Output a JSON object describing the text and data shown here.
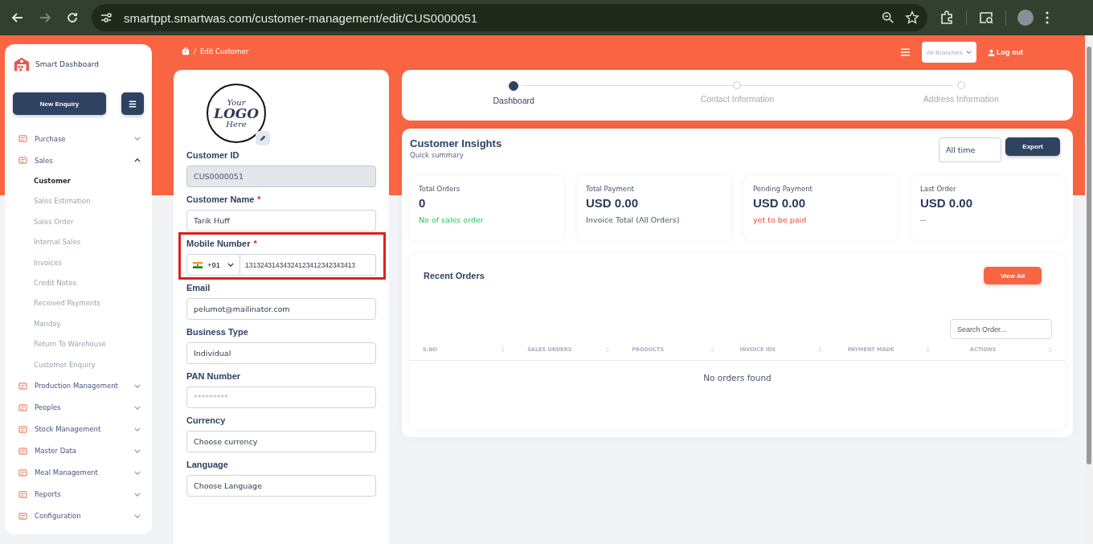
{
  "browser": {
    "url": "smartppt.smartwas.com/customer-management/edit/CUS0000051"
  },
  "sidebar": {
    "brand": "Smart Dashboard",
    "primary_button": "New Enquiry",
    "items": [
      {
        "label": "Purchase",
        "expanded": false
      },
      {
        "label": "Sales",
        "expanded": true,
        "children": [
          {
            "label": "Customer",
            "selected": true
          },
          {
            "label": "Sales Estimation",
            "selected": false
          },
          {
            "label": "Sales Order",
            "selected": false
          },
          {
            "label": "Internal Sales",
            "selected": false
          },
          {
            "label": "Invoices",
            "selected": false
          },
          {
            "label": "Credit Notes",
            "selected": false
          },
          {
            "label": "Received Payments",
            "selected": false
          },
          {
            "label": "Manday",
            "selected": false
          },
          {
            "label": "Return To Warehouse",
            "selected": false
          },
          {
            "label": "Customer Enquiry",
            "selected": false
          }
        ]
      },
      {
        "label": "Production Management",
        "expanded": false
      },
      {
        "label": "Peoples",
        "expanded": false
      },
      {
        "label": "Stock Management",
        "expanded": false
      },
      {
        "label": "Master Data",
        "expanded": false
      },
      {
        "label": "Meal Management",
        "expanded": false
      },
      {
        "label": "Reports",
        "expanded": false
      },
      {
        "label": "Configuration",
        "expanded": false
      }
    ]
  },
  "header": {
    "breadcrumb_separator": "/",
    "breadcrumb": "Edit Customer",
    "branch_placeholder": "All Branches",
    "logout": "Log out"
  },
  "form": {
    "logo": [
      "Your",
      "LOGO",
      "Here"
    ],
    "fields": [
      {
        "kind": "text",
        "label": "Customer ID",
        "disabled": true,
        "value": "CUS0000051"
      },
      {
        "kind": "text",
        "label": "Customer Name",
        "required_mark": "*",
        "disabled": false,
        "value": "Tarik Huff"
      },
      {
        "kind": "phone",
        "label": "Mobile Number",
        "required_mark": "*",
        "code": "+91",
        "value": "13132431434324123412342343413",
        "highlighted": true
      },
      {
        "kind": "text",
        "label": "Email",
        "disabled": false,
        "value": "pelumot@mailinator.com"
      },
      {
        "kind": "text",
        "label": "Business Type",
        "disabled": false,
        "value": "Individual"
      },
      {
        "kind": "text",
        "label": "PAN Number",
        "disabled": false,
        "placeholder": "*********"
      },
      {
        "kind": "text",
        "label": "Currency",
        "disabled": false,
        "value": "Choose currency"
      },
      {
        "kind": "text",
        "label": "Language",
        "disabled": false,
        "value": "Choose Language"
      }
    ]
  },
  "stepper": [
    {
      "label": "Dashboard",
      "selected": true
    },
    {
      "label": "Contact Information",
      "selected": false
    },
    {
      "label": "Address Information",
      "selected": false
    }
  ],
  "insights": {
    "title": "Customer Insights",
    "subtitle": "Quick summary",
    "period": "All time",
    "export": "Export",
    "stats": [
      {
        "label": "Total Orders",
        "value": "0",
        "note": "No of sales order",
        "kind": "positive"
      },
      {
        "label": "Total Payment",
        "value": "USD 0.00",
        "note": "Invoice Total (All Orders)",
        "kind": "neutral"
      },
      {
        "label": "Pending Payment",
        "value": "USD 0.00",
        "note": "yet to be paid",
        "kind": "negative"
      },
      {
        "label": "Last Order",
        "value": "USD 0.00",
        "note": "--",
        "kind": "neutral"
      }
    ]
  },
  "recent_orders": {
    "title": "Recent Orders",
    "view_all": "View All",
    "search_placeholder": "Search Order...",
    "columns": [
      "S.NO",
      "SALES ORDERS",
      "PRODUCTS",
      "INVOICE IDS",
      "PAYMENT MADE",
      "ACTIONS"
    ],
    "empty": "No orders found"
  }
}
